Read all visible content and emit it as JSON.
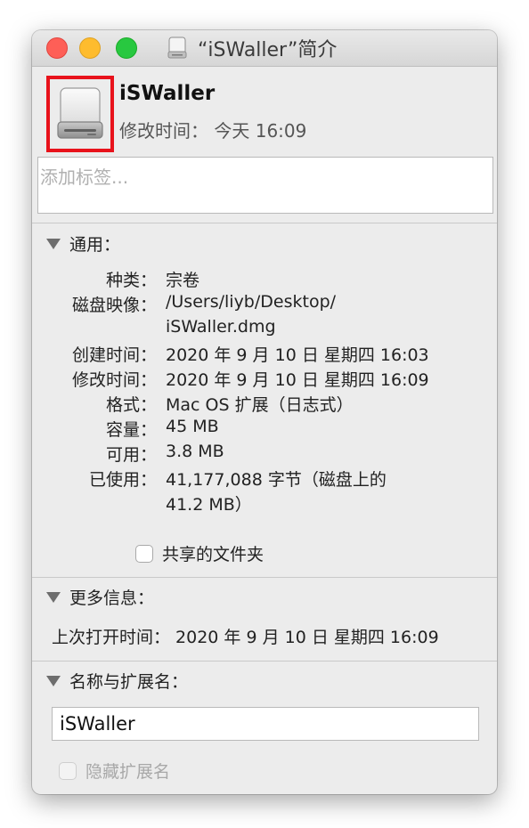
{
  "window": {
    "title": "“iSWaller”简介",
    "controls": {
      "close": "close-button",
      "minimize": "minimize-button",
      "zoom": "zoom-button"
    }
  },
  "header": {
    "file_name": "iSWaller",
    "modified_label": "修改时间：",
    "modified_value": "今天 16:09",
    "icon": "disk-image-drive-icon"
  },
  "tags": {
    "placeholder": "添加标签..."
  },
  "general": {
    "title": "通用：",
    "rows": [
      {
        "label": "种类：",
        "value": "宗卷"
      },
      {
        "label": "磁盘映像：",
        "value": "/Users/liyb/Desktop/",
        "value2": "iSWaller.dmg"
      },
      {
        "label": "创建时间：",
        "value": "2020 年 9 月 10 日 星期四 16:03"
      },
      {
        "label": "修改时间：",
        "value": "2020 年 9 月 10 日 星期四 16:09"
      },
      {
        "label": "格式：",
        "value": "Mac OS 扩展（日志式）"
      },
      {
        "label": "容量：",
        "value": "45 MB"
      },
      {
        "label": "可用：",
        "value": "3.8 MB"
      },
      {
        "label": "已使用：",
        "value": "41,177,088 字节（磁盘上的",
        "value2": "41.2 MB）"
      }
    ],
    "shared_folder_label": "共享的文件夹"
  },
  "more_info": {
    "title": "更多信息：",
    "last_opened": "上次打开时间：  2020 年 9 月 10 日 星期四 16:09"
  },
  "name_ext": {
    "title": "名称与扩展名：",
    "name_value": "iSWaller",
    "hide_extension_label": "隐藏扩展名"
  },
  "colors": {
    "highlight": "#e8121b",
    "close": "#fe5f57",
    "minimize": "#febc2e",
    "zoom": "#28c840"
  }
}
